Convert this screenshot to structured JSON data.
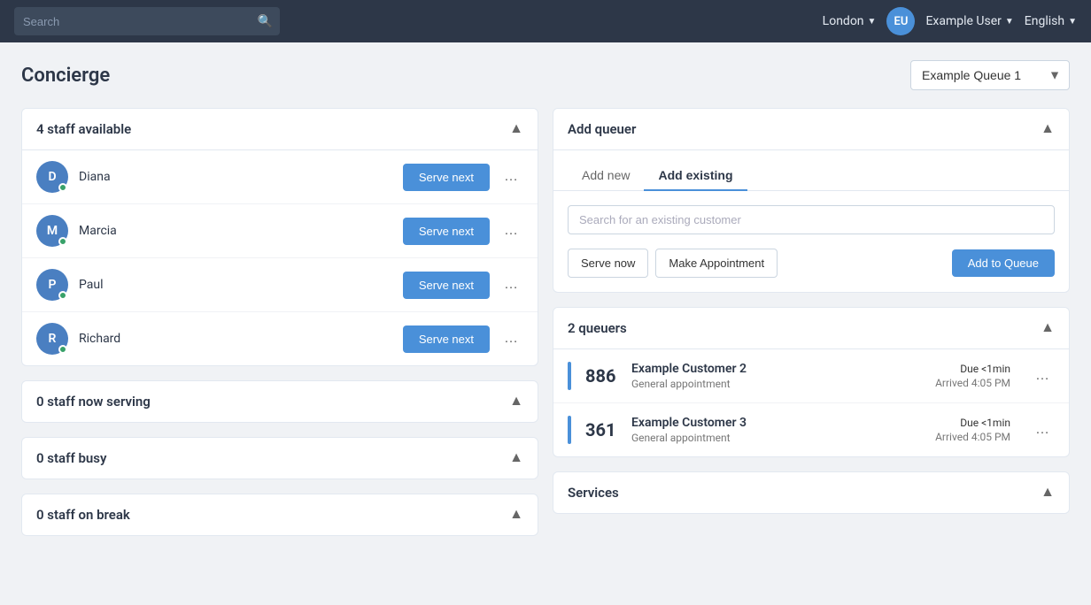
{
  "nav": {
    "search_placeholder": "Search",
    "location": "London",
    "user_initials": "EU",
    "user_name": "Example User",
    "language": "English"
  },
  "page": {
    "title": "Concierge",
    "queue_label": "Example Queue 1"
  },
  "staff_panel": {
    "title": "4 staff available",
    "members": [
      {
        "initial": "D",
        "name": "Diana",
        "color": "#4a7fc1"
      },
      {
        "initial": "M",
        "name": "Marcia",
        "color": "#4a7fc1"
      },
      {
        "initial": "P",
        "name": "Paul",
        "color": "#4a7fc1"
      },
      {
        "initial": "R",
        "name": "Richard",
        "color": "#4a7fc1"
      }
    ],
    "serve_next_label": "Serve next"
  },
  "serving_panel": {
    "title": "0 staff now serving"
  },
  "busy_panel": {
    "title": "0 staff busy"
  },
  "break_panel": {
    "title": "0 staff on break"
  },
  "add_queuer": {
    "title": "Add queuer",
    "tab_add_new": "Add new",
    "tab_add_existing": "Add existing",
    "search_placeholder": "Search for an existing customer",
    "serve_now_label": "Serve now",
    "make_appointment_label": "Make Appointment",
    "add_to_queue_label": "Add to Queue"
  },
  "queuers_panel": {
    "title": "2 queuers",
    "items": [
      {
        "number": "886",
        "name": "Example Customer 2",
        "type": "General appointment",
        "due_label": "Due",
        "due_value": "<1min",
        "arrived_label": "Arrived",
        "arrived_value": "4:05 PM"
      },
      {
        "number": "361",
        "name": "Example Customer 3",
        "type": "General appointment",
        "due_label": "Due",
        "due_value": "<1min",
        "arrived_label": "Arrived",
        "arrived_value": "4:05 PM"
      }
    ]
  },
  "services_panel": {
    "title": "Services"
  }
}
